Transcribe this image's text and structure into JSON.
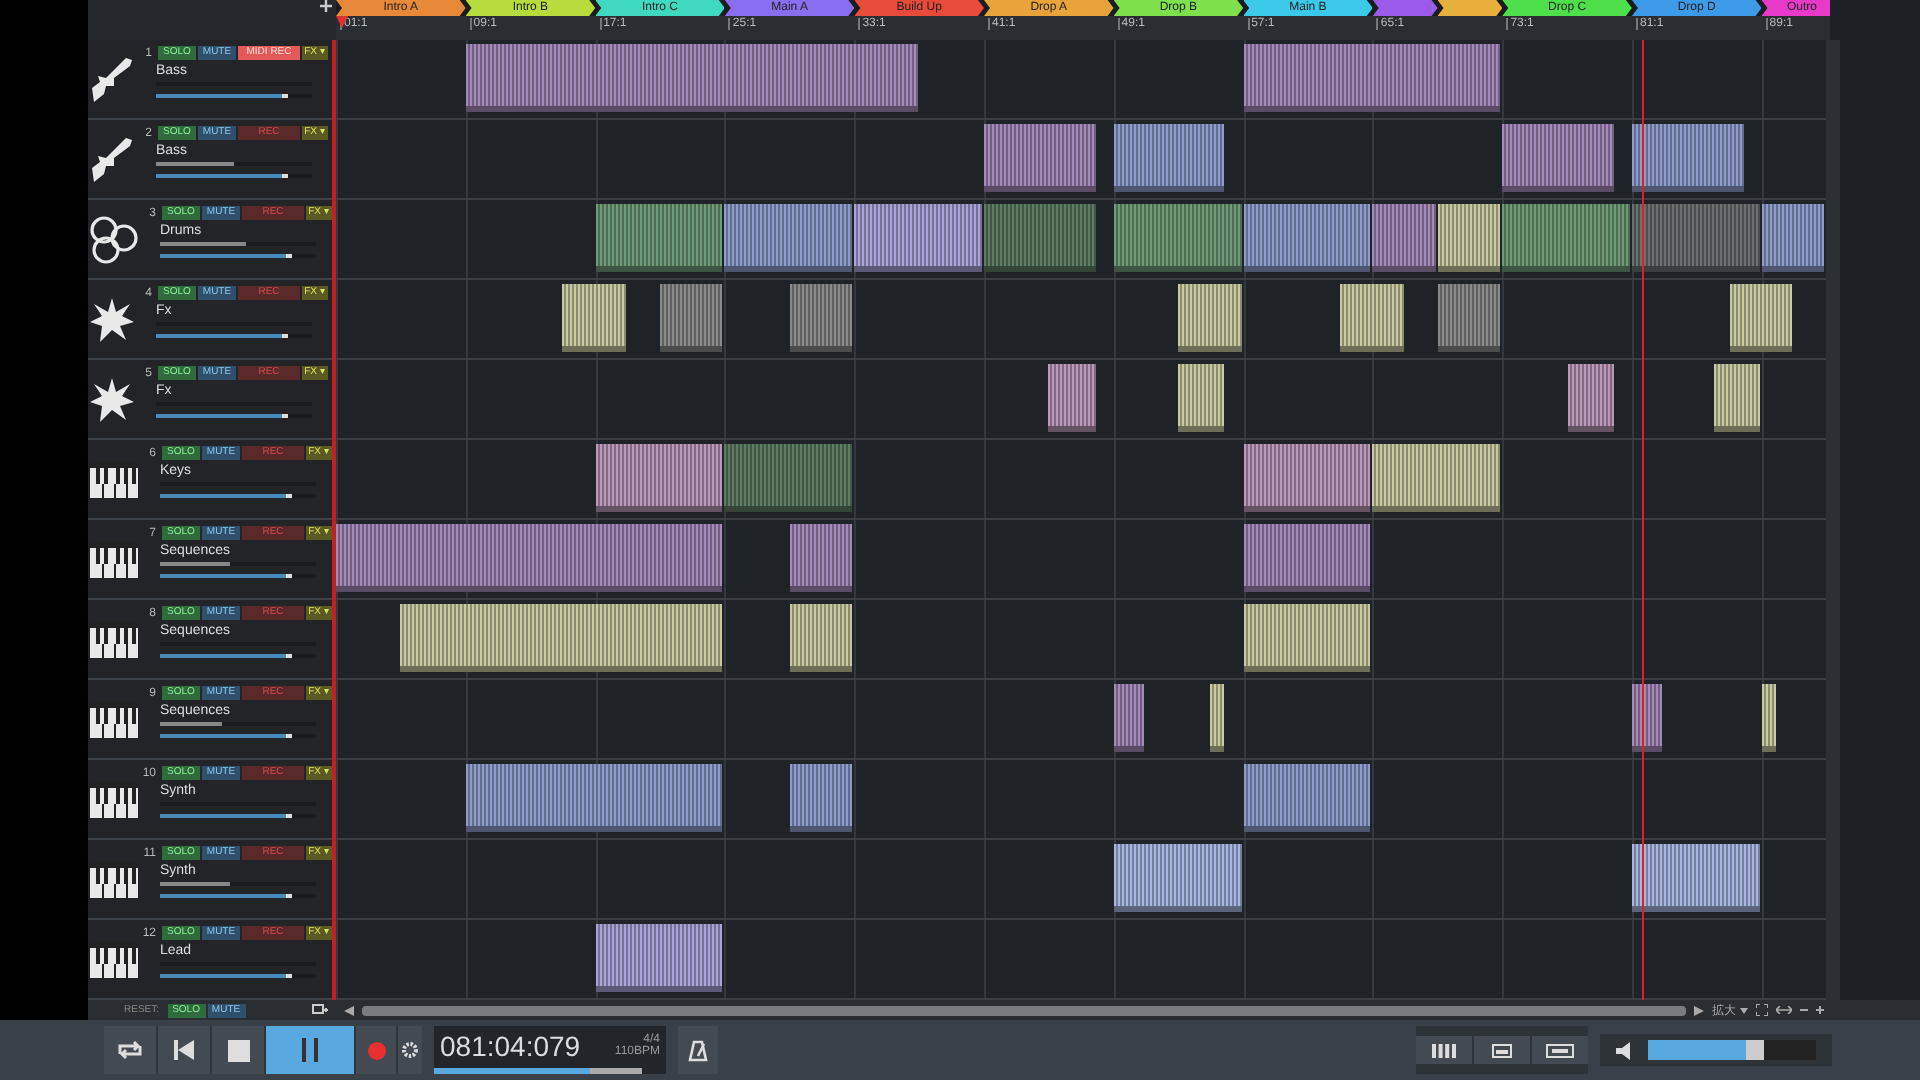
{
  "markers": [
    {
      "name": "Intro A",
      "color": "#e8893a"
    },
    {
      "name": "Intro B",
      "color": "#b6dd3c"
    },
    {
      "name": "Intro C",
      "color": "#3fd8c0"
    },
    {
      "name": "Main A",
      "color": "#8a6ef0"
    },
    {
      "name": "Build Up",
      "color": "#e84b3a"
    },
    {
      "name": "Drop A",
      "color": "#e8a43a"
    },
    {
      "name": "Drop B",
      "color": "#7ee04a"
    },
    {
      "name": "Main B",
      "color": "#3cc8e8"
    },
    {
      "color": "#9a5ce8"
    },
    {
      "color": "#e8b03a"
    },
    {
      "name": "Drop C",
      "color": "#4ee04a"
    },
    {
      "name": "Drop D",
      "color": "#3c9ae8"
    },
    {
      "name": "Outro",
      "color": "#e83ac8"
    }
  ],
  "ruler": [
    "01:1",
    "09:1",
    "17:1",
    "25:1",
    "33:1",
    "41:1",
    "49:1",
    "57:1",
    "65:1",
    "73:1",
    "81:1",
    "89:1"
  ],
  "tracks": [
    {
      "number": "1",
      "kind": "guitar",
      "name": "Bass",
      "rec": "MIDI REC",
      "armed": true,
      "volume": {
        "level": 0.85
      }
    },
    {
      "number": "2",
      "kind": "guitar",
      "name": "Bass",
      "rec": "REC",
      "armed": false,
      "meter": {
        "level": 0.5
      },
      "volume": {
        "level": 0.85
      }
    },
    {
      "number": "3",
      "kind": "drums",
      "name": "Drums",
      "rec": "REC",
      "armed": false,
      "meter": {
        "level": 0.55
      },
      "volume": {
        "level": 0.85
      }
    },
    {
      "number": "4",
      "kind": "fx",
      "name": "Fx",
      "rec": "REC",
      "armed": false,
      "volume": {
        "level": 0.85
      }
    },
    {
      "number": "5",
      "kind": "fx",
      "name": "Fx",
      "rec": "REC",
      "armed": false,
      "volume": {
        "level": 0.85
      }
    },
    {
      "number": "6",
      "kind": "keys",
      "name": "Keys",
      "rec": "REC",
      "armed": false,
      "volume": {
        "level": 0.85
      }
    },
    {
      "number": "7",
      "kind": "keys",
      "name": "Sequences",
      "rec": "REC",
      "armed": false,
      "meter": {
        "level": 0.45
      },
      "volume": {
        "level": 0.85
      }
    },
    {
      "number": "8",
      "kind": "keys",
      "name": "Sequences",
      "rec": "REC",
      "armed": false,
      "volume": {
        "level": 0.85
      }
    },
    {
      "number": "9",
      "kind": "keys",
      "name": "Sequences",
      "rec": "REC",
      "armed": false,
      "meter": {
        "level": 0.4
      },
      "volume": {
        "level": 0.85
      }
    },
    {
      "number": "10",
      "kind": "keys",
      "name": "Synth",
      "rec": "REC",
      "armed": false,
      "volume": {
        "level": 0.85
      }
    },
    {
      "number": "11",
      "kind": "keys",
      "name": "Synth",
      "rec": "REC",
      "armed": false,
      "meter": {
        "level": 0.45
      },
      "volume": {
        "level": 0.85
      }
    },
    {
      "number": "12",
      "kind": "keys",
      "name": "Lead",
      "rec": "REC",
      "armed": false,
      "volume": {
        "level": 0.85
      }
    }
  ],
  "track_buttons": [
    {
      "solo": "SOLO",
      "mute": "MUTE",
      "fx": "FX ▾"
    },
    {
      "solo": "SOLO",
      "mute": "MUTE",
      "fx": "FX ▾"
    },
    {
      "solo": "SOLO",
      "mute": "MUTE",
      "fx": "FX ▾"
    },
    {
      "solo": "SOLO",
      "mute": "MUTE",
      "fx": "FX ▾"
    },
    {
      "solo": "SOLO",
      "mute": "MUTE",
      "fx": "FX ▾"
    },
    {
      "solo": "SOLO",
      "mute": "MUTE",
      "fx": "FX ▾"
    },
    {
      "solo": "SOLO",
      "mute": "MUTE",
      "fx": "FX ▾"
    },
    {
      "solo": "SOLO",
      "mute": "MUTE",
      "fx": "FX ▾"
    },
    {
      "solo": "SOLO",
      "mute": "MUTE",
      "fx": "FX ▾"
    },
    {
      "solo": "SOLO",
      "mute": "MUTE",
      "fx": "FX ▾"
    },
    {
      "solo": "SOLO",
      "mute": "MUTE",
      "fx": "FX ▾"
    },
    {
      "solo": "SOLO",
      "mute": "MUTE",
      "fx": "FX ▾"
    }
  ],
  "reset": {
    "label": "RESET:",
    "solo": "SOLO",
    "mute": "MUTE"
  },
  "zoom_label": "拡大",
  "transport": {
    "paused": true,
    "time": "081:04:079",
    "signature": "4/4",
    "tempo": "110BPM",
    "progress": {
      "level": 0.75
    }
  },
  "master_volume": {
    "level": 0.6
  }
}
